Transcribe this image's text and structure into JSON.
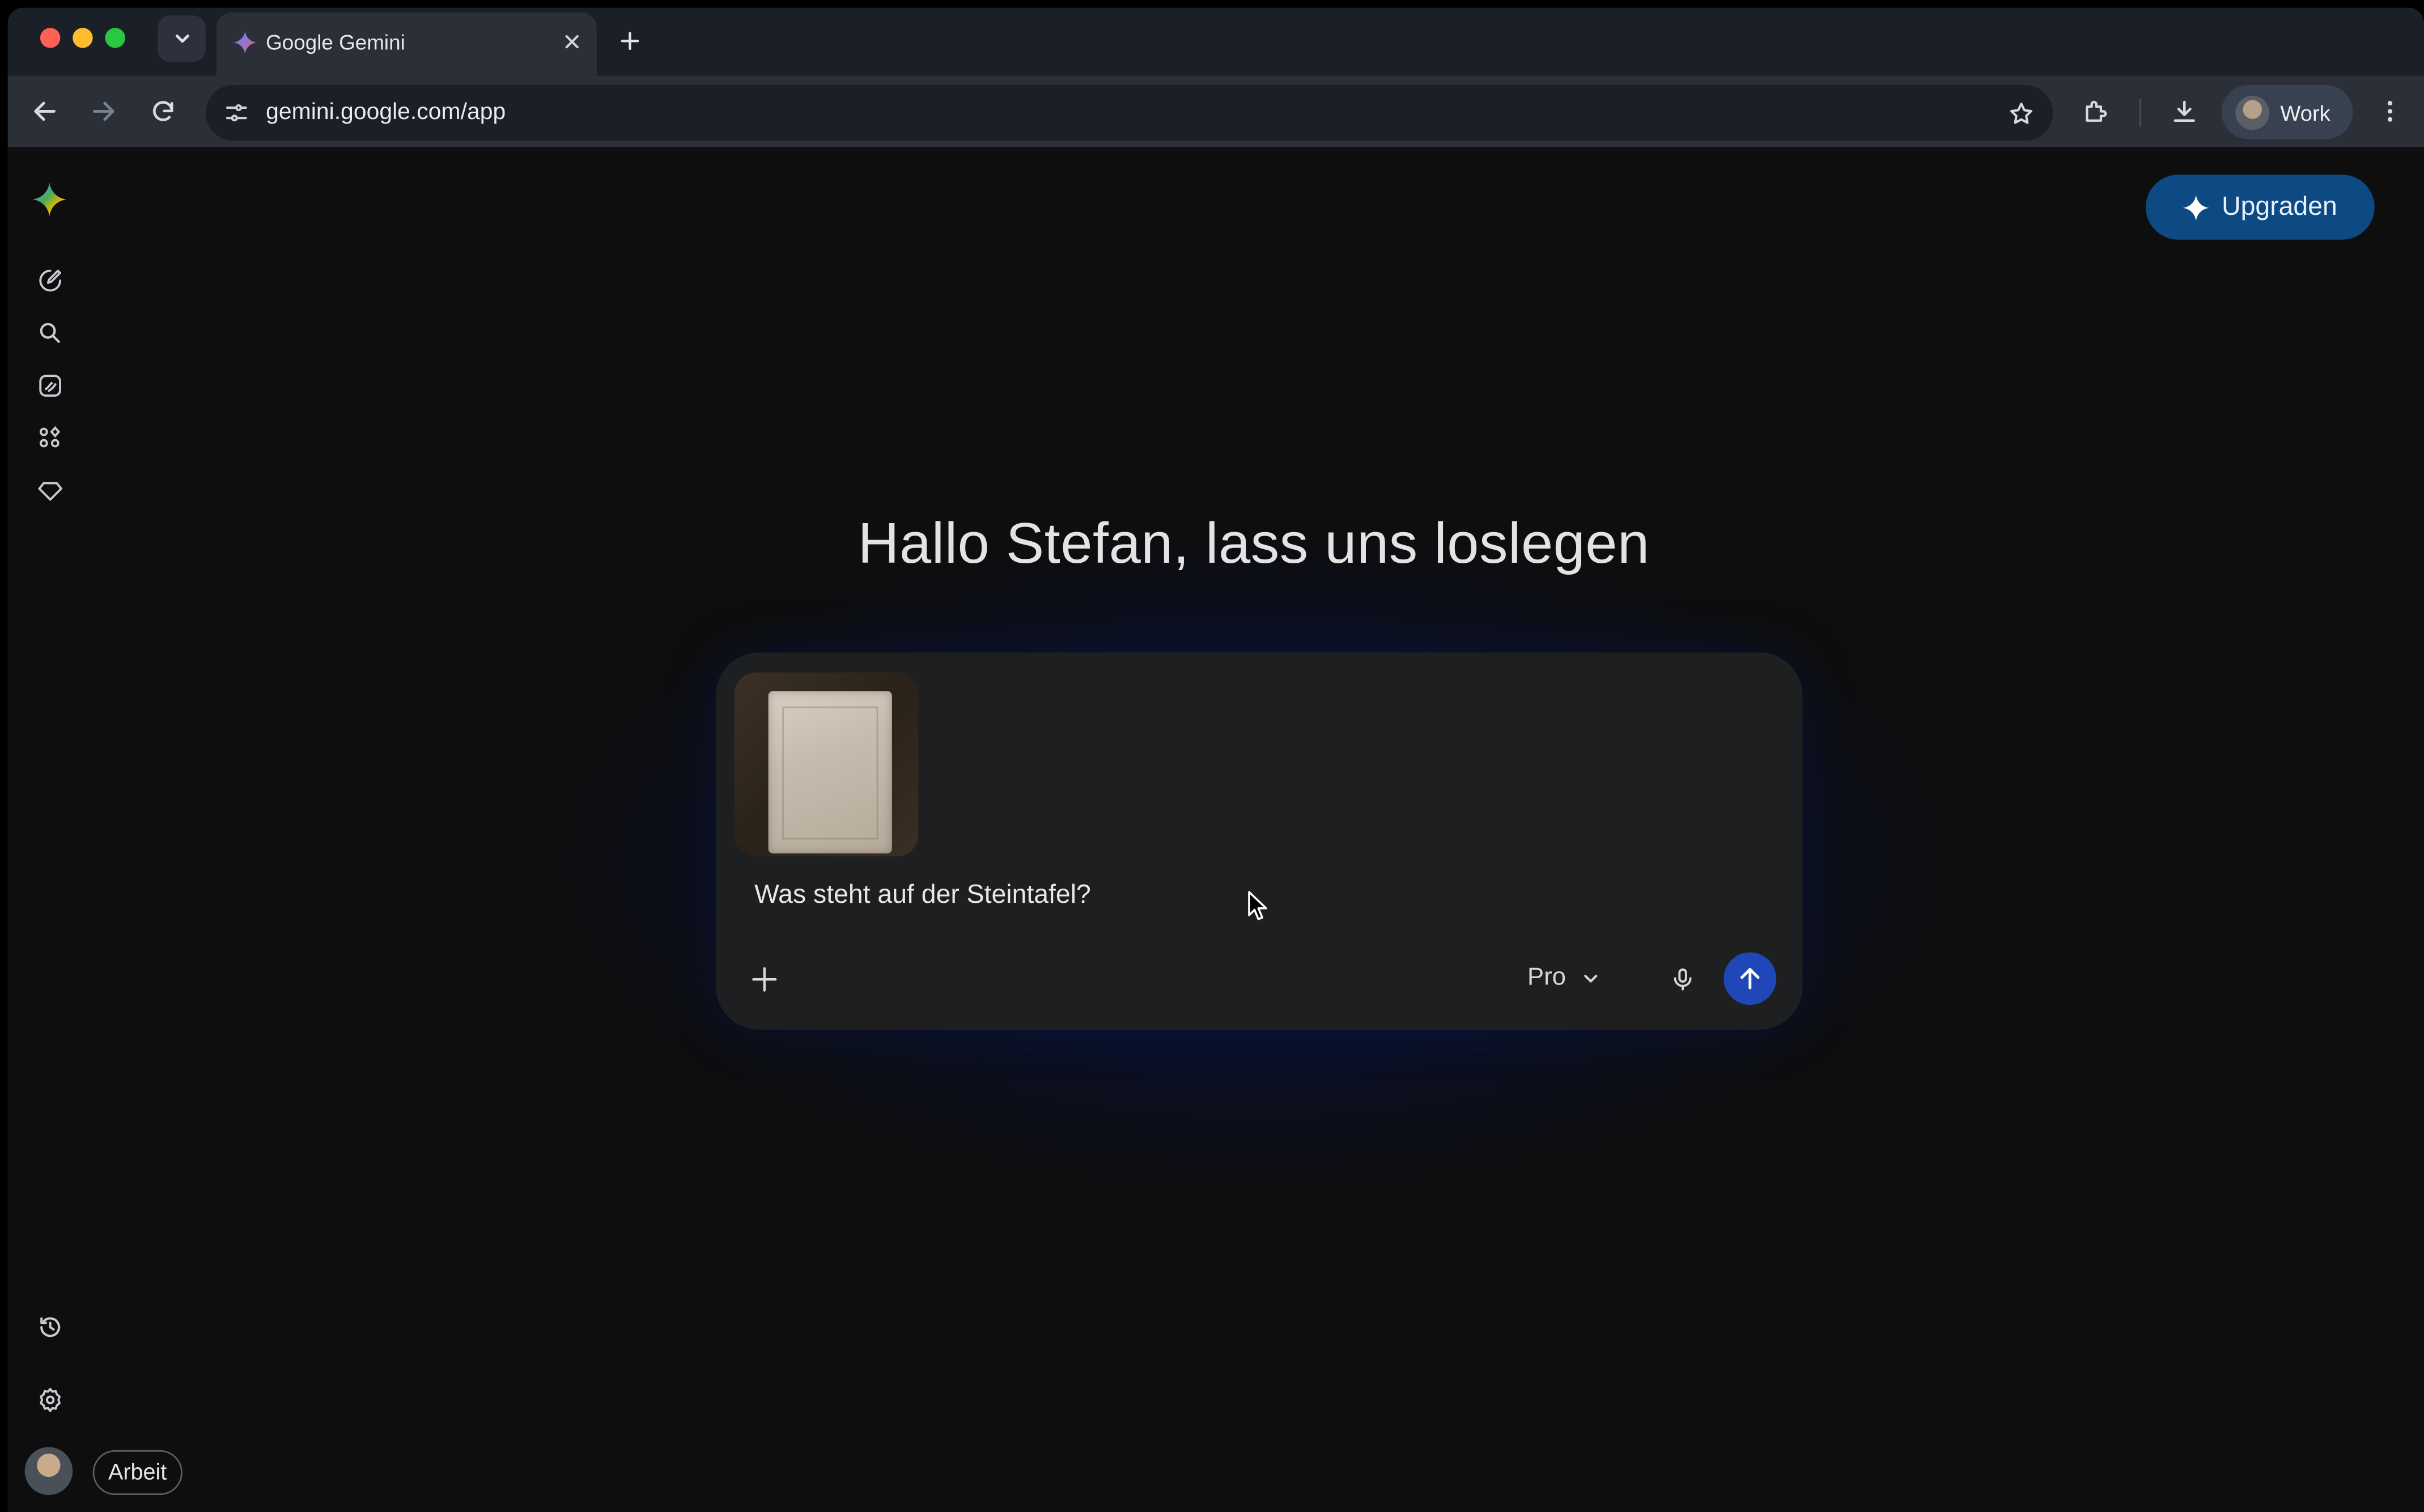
{
  "browser": {
    "tab_title": "Google Gemini",
    "url": "gemini.google.com/app",
    "profile_label": "Work"
  },
  "app": {
    "upgrade_label": "Upgraden",
    "greeting": "Hallo Stefan, lass uns loslegen",
    "composer": {
      "prompt_text": "Was steht auf der Steintafel?",
      "model_label": "Pro"
    },
    "workspace_label": "Arbeit"
  },
  "icons": {
    "rail": [
      "new-chat-icon",
      "search-icon",
      "gems-icon",
      "apps-icon",
      "diamond-icon",
      "history-icon",
      "settings-icon"
    ]
  },
  "colors": {
    "accent_upgrade": "#0d4a83",
    "send_button": "#1f47b8",
    "composer_bg": "#1e1f20"
  }
}
